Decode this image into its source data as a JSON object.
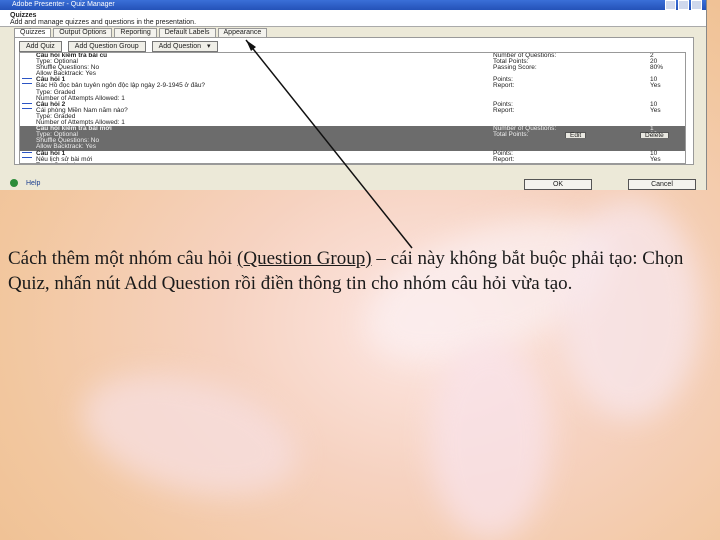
{
  "window": {
    "title": "Adobe Presenter - Quiz Manager",
    "header_title": "Quizzes",
    "header_subtitle": "Add and manage quizzes and questions in the presentation."
  },
  "tabs": [
    "Quizzes",
    "Output Options",
    "Reporting",
    "Default Labels",
    "Appearance"
  ],
  "toolbar": {
    "add_quiz": "Add Quiz",
    "add_question_group": "Add Question Group",
    "add_question": "Add Question"
  },
  "rows": [
    {
      "l": "Câu hỏi kiểm tra bài cũ",
      "rl": "Number of Questions:",
      "rv": "2",
      "bold": true,
      "icon": false,
      "sel": false
    },
    {
      "l": "Type: Optional",
      "rl": "Total Points:",
      "rv": "20",
      "bold": false,
      "icon": false,
      "sel": false
    },
    {
      "l": "Shuffle Questions: No",
      "rl": "Passing Score:",
      "rv": "80%",
      "bold": false,
      "icon": false,
      "sel": false
    },
    {
      "l": "Allow Backtrack: Yes",
      "rl": "",
      "rv": "",
      "bold": false,
      "icon": false,
      "sel": false
    },
    {
      "l": "Câu hỏi 1",
      "rl": "Points:",
      "rv": "10",
      "bold": true,
      "icon": true,
      "sel": false
    },
    {
      "l": "Bác Hồ đọc bản tuyên ngôn độc lập ngày 2-9-1945 ở đâu?",
      "rl": "Report:",
      "rv": "Yes",
      "bold": false,
      "icon": false,
      "sel": false
    },
    {
      "l": "Type: Graded",
      "rl": "",
      "rv": "",
      "bold": false,
      "icon": false,
      "sel": false
    },
    {
      "l": "Number of Attempts Allowed: 1",
      "rl": "",
      "rv": "",
      "bold": false,
      "icon": false,
      "sel": false
    },
    {
      "l": "Câu hỏi 2",
      "rl": "Points:",
      "rv": "10",
      "bold": true,
      "icon": true,
      "sel": false
    },
    {
      "l": "Cái phòng Miền Nam năm nào?",
      "rl": "Report:",
      "rv": "Yes",
      "bold": false,
      "icon": false,
      "sel": false
    },
    {
      "l": "Type: Graded",
      "rl": "",
      "rv": "",
      "bold": false,
      "icon": false,
      "sel": false
    },
    {
      "l": "Number of Attempts Allowed: 1",
      "rl": "",
      "rv": "",
      "bold": false,
      "icon": false,
      "sel": false
    },
    {
      "l": "Câu hỏi kiểm tra bài mới",
      "rl": "Number of Questions:",
      "rv": "1",
      "bold": true,
      "icon": false,
      "sel": true
    },
    {
      "l": "Type: Optional",
      "rl": "Total Points:",
      "rv": "10",
      "bold": false,
      "icon": false,
      "sel": true
    },
    {
      "l": "Shuffle Questions: No",
      "rl": "",
      "rv": "",
      "bold": false,
      "icon": false,
      "sel": true
    },
    {
      "l": "Allow Backtrack: Yes",
      "rl": "",
      "rv": "",
      "bold": false,
      "icon": false,
      "sel": true
    },
    {
      "l": "Câu hỏi 1",
      "rl": "Points:",
      "rv": "10",
      "bold": true,
      "icon": true,
      "sel": false
    },
    {
      "l": "Nêu lịch sử bài mới",
      "rl": "Report:",
      "rv": "Yes",
      "bold": false,
      "icon": false,
      "sel": false
    },
    {
      "l": "Type: Graded",
      "rl": "",
      "rv": "",
      "bold": false,
      "icon": false,
      "sel": false
    },
    {
      "l": "Number of Attempts Allowed: 1",
      "rl": "",
      "rv": "",
      "bold": false,
      "icon": false,
      "sel": false
    }
  ],
  "row_buttons": {
    "edit": "Edit",
    "delete": "Delete"
  },
  "footer": {
    "help": "Help",
    "ok": "OK",
    "cancel": "Cancel"
  },
  "caption": {
    "before": "Cách thêm một nhóm câu hỏi ",
    "underlined": "(Question Group)",
    "after": " – cái này không bắt buộc phải tạo: Chọn Quiz, nhấn nút Add Question rồi điền thông tin cho nhóm câu hỏi vừa tạo."
  }
}
